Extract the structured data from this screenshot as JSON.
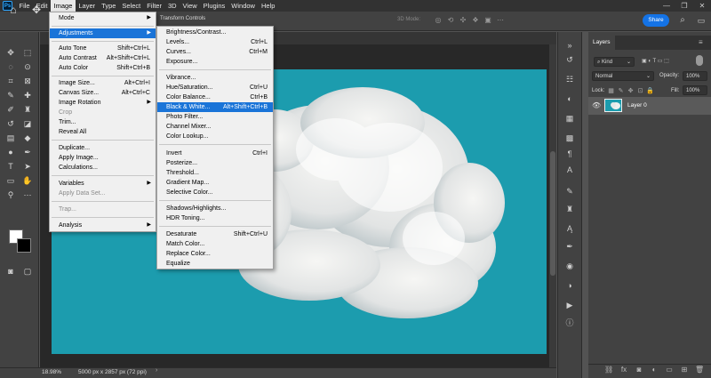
{
  "menubar": {
    "logo": "Ps",
    "items": [
      "File",
      "Edit",
      "Image",
      "Layer",
      "Type",
      "Select",
      "Filter",
      "3D",
      "View",
      "Plugins",
      "Window",
      "Help"
    ],
    "active": "Image",
    "window_controls": [
      "—",
      "❐",
      "✕"
    ]
  },
  "options_bar": {
    "transform_controls_label": "Transform Controls",
    "mode_3d_label": "3D Mode:",
    "share_label": "Share"
  },
  "image_menu": {
    "items": [
      {
        "label": "Mode",
        "shortcut": "",
        "submenu": true,
        "disabled": false
      },
      {
        "label": "Adjustments",
        "shortcut": "",
        "submenu": true,
        "disabled": false
      },
      {
        "label": "Auto Tone",
        "shortcut": "Shift+Ctrl+L",
        "submenu": false,
        "disabled": false
      },
      {
        "label": "Auto Contrast",
        "shortcut": "Alt+Shift+Ctrl+L",
        "submenu": false,
        "disabled": false
      },
      {
        "label": "Auto Color",
        "shortcut": "Shift+Ctrl+B",
        "submenu": false,
        "disabled": false
      },
      {
        "label": "Image Size...",
        "shortcut": "Alt+Ctrl+I",
        "submenu": false,
        "disabled": false
      },
      {
        "label": "Canvas Size...",
        "shortcut": "Alt+Ctrl+C",
        "submenu": false,
        "disabled": false
      },
      {
        "label": "Image Rotation",
        "shortcut": "",
        "submenu": true,
        "disabled": false
      },
      {
        "label": "Crop",
        "shortcut": "",
        "submenu": false,
        "disabled": true
      },
      {
        "label": "Trim...",
        "shortcut": "",
        "submenu": false,
        "disabled": false
      },
      {
        "label": "Reveal All",
        "shortcut": "",
        "submenu": false,
        "disabled": false
      },
      {
        "label": "Duplicate...",
        "shortcut": "",
        "submenu": false,
        "disabled": false
      },
      {
        "label": "Apply Image...",
        "shortcut": "",
        "submenu": false,
        "disabled": false
      },
      {
        "label": "Calculations...",
        "shortcut": "",
        "submenu": false,
        "disabled": false
      },
      {
        "label": "Variables",
        "shortcut": "",
        "submenu": true,
        "disabled": false
      },
      {
        "label": "Apply Data Set...",
        "shortcut": "",
        "submenu": false,
        "disabled": true
      },
      {
        "label": "Trap...",
        "shortcut": "",
        "submenu": false,
        "disabled": true
      },
      {
        "label": "Analysis",
        "shortcut": "",
        "submenu": true,
        "disabled": false
      }
    ]
  },
  "adjustments_menu": {
    "items": [
      {
        "label": "Brightness/Contrast...",
        "shortcut": ""
      },
      {
        "label": "Levels...",
        "shortcut": "Ctrl+L"
      },
      {
        "label": "Curves...",
        "shortcut": "Ctrl+M"
      },
      {
        "label": "Exposure...",
        "shortcut": ""
      },
      {
        "label": "Vibrance...",
        "shortcut": ""
      },
      {
        "label": "Hue/Saturation...",
        "shortcut": "Ctrl+U"
      },
      {
        "label": "Color Balance...",
        "shortcut": "Ctrl+B"
      },
      {
        "label": "Black & White...",
        "shortcut": "Alt+Shift+Ctrl+B"
      },
      {
        "label": "Photo Filter...",
        "shortcut": ""
      },
      {
        "label": "Channel Mixer...",
        "shortcut": ""
      },
      {
        "label": "Color Lookup...",
        "shortcut": ""
      },
      {
        "label": "Invert",
        "shortcut": "Ctrl+I"
      },
      {
        "label": "Posterize...",
        "shortcut": ""
      },
      {
        "label": "Threshold...",
        "shortcut": ""
      },
      {
        "label": "Gradient Map...",
        "shortcut": ""
      },
      {
        "label": "Selective Color...",
        "shortcut": ""
      },
      {
        "label": "Shadows/Highlights...",
        "shortcut": ""
      },
      {
        "label": "HDR Toning...",
        "shortcut": ""
      },
      {
        "label": "Desaturate",
        "shortcut": "Shift+Ctrl+U"
      },
      {
        "label": "Match Color...",
        "shortcut": ""
      },
      {
        "label": "Replace Color...",
        "shortcut": ""
      },
      {
        "label": "Equalize",
        "shortcut": ""
      }
    ],
    "highlighted": "Black & White..."
  },
  "layers_panel": {
    "tab_label": "Layers",
    "filter_kind": "Kind",
    "blend_mode": "Normal",
    "opacity_label": "Opacity:",
    "opacity_value": "100%",
    "lock_label": "Lock:",
    "fill_label": "Fill:",
    "fill_value": "100%",
    "layers": [
      {
        "name": "Layer 0",
        "visible": true
      }
    ]
  },
  "status_bar": {
    "zoom": "18.98%",
    "doc_info": "5000 px x 2857 px (72 ppi)"
  },
  "colors": {
    "sky": "#1c9cae",
    "highlight": "#1a74d8",
    "share": "#1473e6"
  }
}
